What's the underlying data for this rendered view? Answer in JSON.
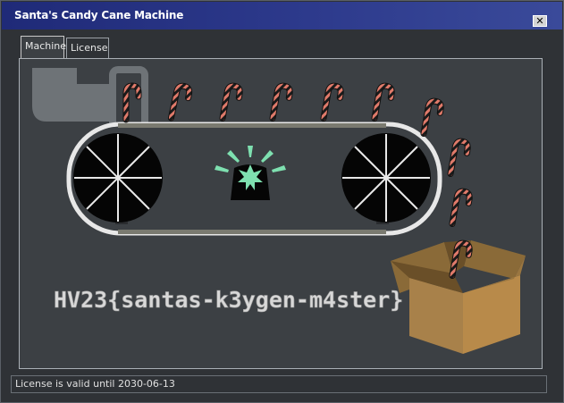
{
  "window": {
    "title": "Santa's Candy Cane Machine"
  },
  "tabs": [
    {
      "label": "Machine",
      "active": true
    },
    {
      "label": "License",
      "active": false
    }
  ],
  "machine": {
    "flag_text": "HV23{santas-k3ygen-m4ster}",
    "colors": {
      "candy_stripe": "#e07a6a",
      "candy_base": "#1a1a1a",
      "siren_light": "#7ee0b0",
      "box": "#b88a4a",
      "belt": "#7a7a70"
    }
  },
  "status": {
    "text": "License is valid until 2030-06-13"
  },
  "icons": {
    "close": "close-icon"
  }
}
